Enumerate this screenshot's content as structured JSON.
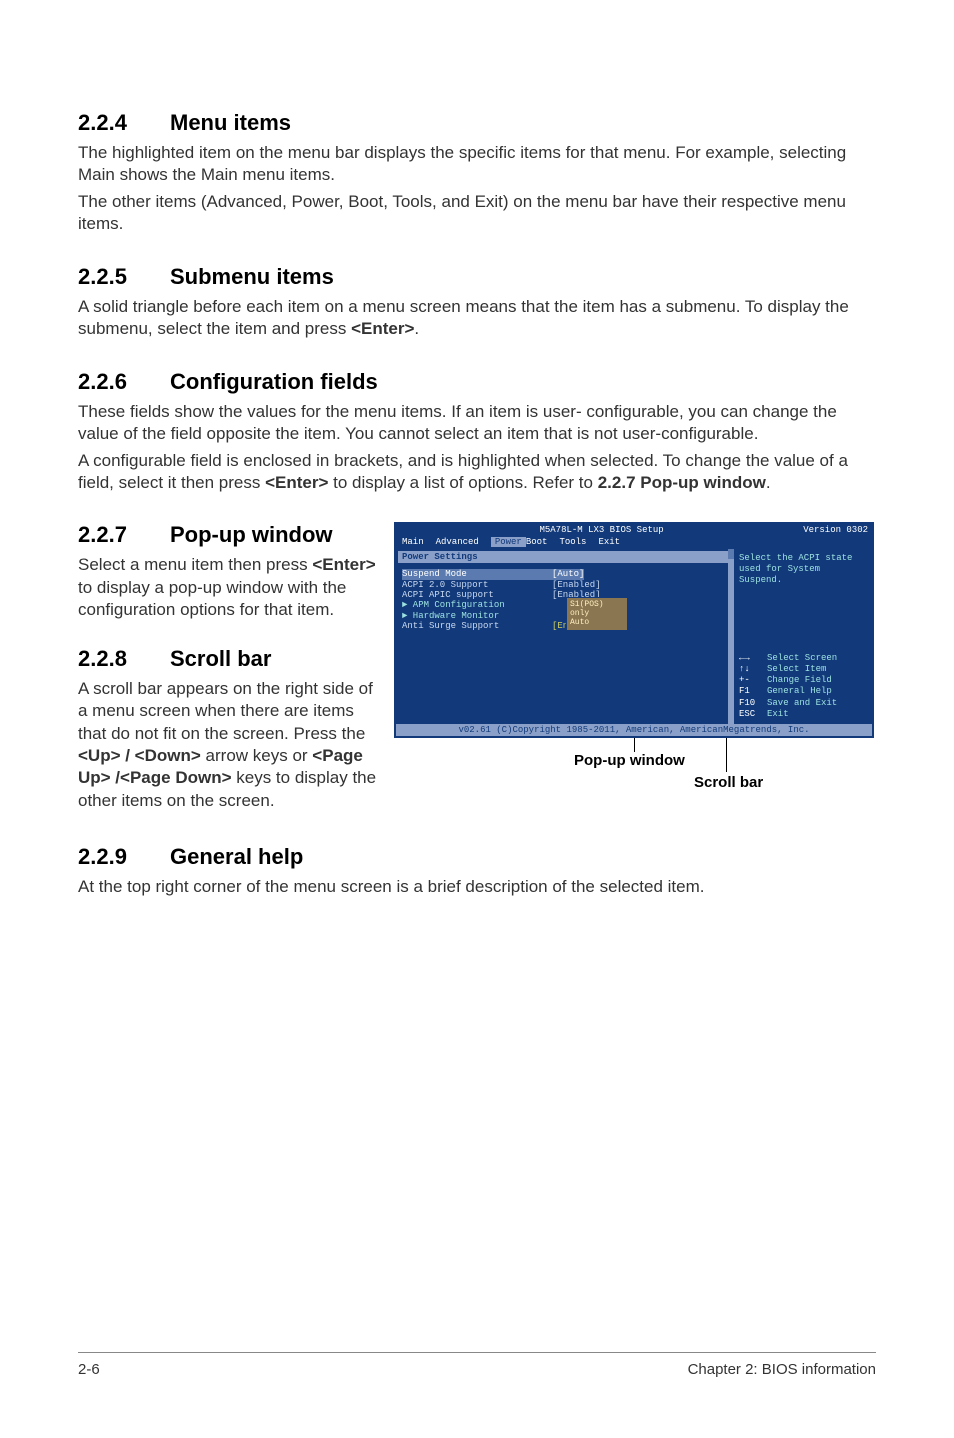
{
  "sections": {
    "s224": {
      "num": "2.2.4",
      "title": "Menu items",
      "p1": "The highlighted item on the menu bar displays the specific items for that menu. For example, selecting Main shows the Main menu items.",
      "p2": "The other items (Advanced, Power, Boot, Tools, and Exit) on the menu bar have their respective menu items."
    },
    "s225": {
      "num": "2.2.5",
      "title": "Submenu items",
      "p1a": "A solid triangle before each item on a menu screen means that the item has a submenu. To display the submenu, select the item and press ",
      "p1b": "<Enter>",
      "p1c": "."
    },
    "s226": {
      "num": "2.2.6",
      "title": "Configuration fields",
      "p1": "These fields show the values for the menu items. If an item is user- configurable, you can change the value of the field opposite the item. You cannot select an item that is not user-configurable.",
      "p2a": "A configurable field is enclosed in brackets, and is highlighted when selected. To change the value of a field, select it then press ",
      "p2b": "<Enter>",
      "p2c": " to display a list of options. Refer to ",
      "p2d": "2.2.7 Pop-up window",
      "p2e": "."
    },
    "s227": {
      "num": "2.2.7",
      "title": "Pop-up window",
      "p1a": "Select a menu item then press ",
      "p1b": "<Enter>",
      "p1c": " to display a pop-up window with the configuration options for that item."
    },
    "s228": {
      "num": "2.2.8",
      "title": "Scroll bar",
      "p1a": "A scroll bar appears on the right side of a menu screen when there are items that do not fit on the screen. Press the ",
      "p1b": "<Up> / <Down>",
      "p1c": " arrow keys or ",
      "p1d": "<Page Up> /<Page Down>",
      "p1e": " keys to display the other items on the screen."
    },
    "s229": {
      "num": "2.2.9",
      "title": "General help",
      "p1": "At the top right corner of the menu screen is a brief description of the selected item."
    }
  },
  "bios": {
    "title_left": "M5A78L-M LX3 BIOS Setup",
    "version": "Version 0302",
    "tabs": [
      "Main",
      "Advanced",
      "Power",
      "Boot",
      "Tools",
      "Exit"
    ],
    "active_tab": "Power",
    "panel_title": "Power Settings",
    "rows": [
      {
        "label": "Suspend Mode",
        "value": "[Auto]",
        "sel": true
      },
      {
        "label": "ACPI 2.0 Support",
        "value": "[Enabled]"
      },
      {
        "label": "ACPI APIC support",
        "value": "[Enabled]"
      },
      {
        "label": "► APM Configuration",
        "value": "",
        "sub": true
      },
      {
        "label": "► Hardware Monitor",
        "value": "",
        "sub": true
      },
      {
        "label": "Anti Surge Support",
        "value": "[Enabled]"
      }
    ],
    "popup": {
      "opt1": "S1(POS) only",
      "opt2": "Auto"
    },
    "help_text": "Select the ACPI state used for System Suspend.",
    "keys": [
      {
        "k": "←→",
        "d": "Select Screen"
      },
      {
        "k": "↑↓",
        "d": "Select Item"
      },
      {
        "k": "+-",
        "d": "Change Field"
      },
      {
        "k": "F1",
        "d": "General Help"
      },
      {
        "k": "F10",
        "d": "Save and Exit"
      },
      {
        "k": "ESC",
        "d": "Exit"
      }
    ],
    "copyright": "v02.61 (C)Copyright 1985-2011, American, AmericanMegatrends, Inc."
  },
  "callouts": {
    "popup": "Pop-up window",
    "scrollbar": "Scroll bar"
  },
  "footer": {
    "left": "2-6",
    "right": "Chapter 2: BIOS information"
  }
}
